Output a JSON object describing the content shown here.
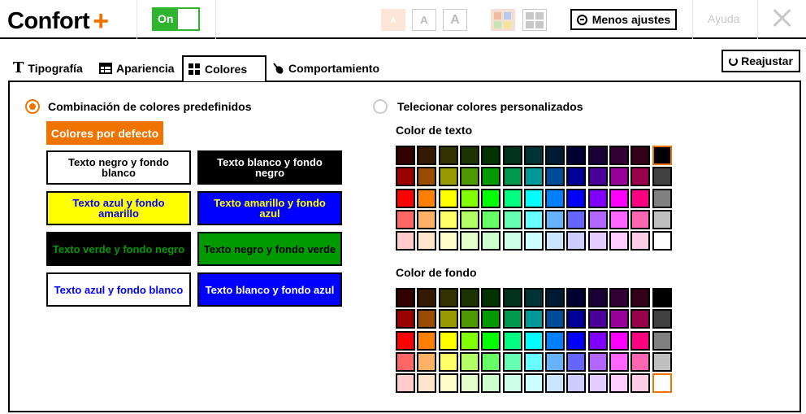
{
  "app": {
    "title": "Confort",
    "plus": "+",
    "toggle_label": "On",
    "font_buttons": [
      "A",
      "A",
      "A"
    ],
    "less_settings": "Menos ajustes",
    "help": "Ayuda"
  },
  "tabs": [
    {
      "label": "Tipografía",
      "icon": "text-icon"
    },
    {
      "label": "Apariencia",
      "icon": "layout-icon"
    },
    {
      "label": "Colores",
      "icon": "grid-icon"
    },
    {
      "label": "Comportamiento",
      "icon": "pointer-icon"
    }
  ],
  "active_tab": "Colores",
  "reset_label": "Reajustar",
  "colors": {
    "predefined_label": "Combinación de colores predefinidos",
    "custom_label": "Telecionar colores personalizados",
    "default_button": "Colores por defecto",
    "combos": [
      {
        "label": "Texto negro y fondo blanco",
        "fg": "#000000",
        "bg": "#ffffff"
      },
      {
        "label": "Texto blanco y fondo negro",
        "fg": "#ffffff",
        "bg": "#000000"
      },
      {
        "label": "Texto azul y fondo amarillo",
        "fg": "#0000ff",
        "bg": "#ffff00"
      },
      {
        "label": "Texto amarillo y fondo azul",
        "fg": "#ffff00",
        "bg": "#0000ff"
      },
      {
        "label": "Texto verde y fondo negro",
        "fg": "#009900",
        "bg": "#000000"
      },
      {
        "label": "Texto negro y fondo verde",
        "fg": "#000000",
        "bg": "#009900"
      },
      {
        "label": "Texto azul y fondo blanco",
        "fg": "#0000ff",
        "bg": "#ffffff"
      },
      {
        "label": "Texto blanco y fondo azul",
        "fg": "#ffffff",
        "bg": "#0000ff"
      }
    ],
    "text_color_title": "Color de texto",
    "bg_color_title": "Color de fondo",
    "palette": [
      [
        "#330000",
        "#331a00",
        "#333300",
        "#1a3300",
        "#003300",
        "#00331a",
        "#003333",
        "#001a33",
        "#000033",
        "#1a0033",
        "#330033",
        "#33001a",
        "#000000"
      ],
      [
        "#990000",
        "#994c00",
        "#999900",
        "#4c9900",
        "#009900",
        "#00994c",
        "#009999",
        "#004c99",
        "#000099",
        "#4c0099",
        "#990099",
        "#99004c",
        "#404040"
      ],
      [
        "#ff0000",
        "#ff8000",
        "#ffff00",
        "#80ff00",
        "#00ff00",
        "#00ff80",
        "#00ffff",
        "#0080ff",
        "#0000ff",
        "#8000ff",
        "#ff00ff",
        "#ff0080",
        "#808080"
      ],
      [
        "#ff6666",
        "#ffb266",
        "#ffff66",
        "#b2ff66",
        "#66ff66",
        "#66ffb2",
        "#66ffff",
        "#66b2ff",
        "#6666ff",
        "#b266ff",
        "#ff66ff",
        "#ff66b2",
        "#c0c0c0"
      ],
      [
        "#ffcccc",
        "#ffe5cc",
        "#ffffcc",
        "#e5ffcc",
        "#ccffcc",
        "#ccffe5",
        "#ccffff",
        "#cce5ff",
        "#ccccff",
        "#e5ccff",
        "#ffccff",
        "#ffcce5",
        "#ffffff"
      ]
    ],
    "selected_text_color": "#000000",
    "selected_bg_color": "#ffffff",
    "accent_color": "#f07300"
  }
}
